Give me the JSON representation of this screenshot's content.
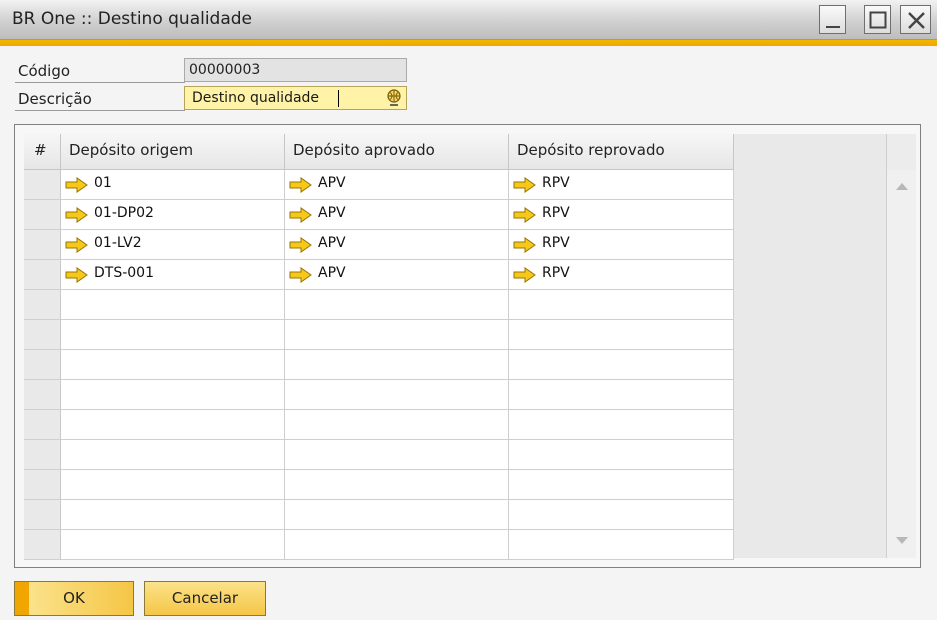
{
  "window": {
    "title": "BR One :: Destino qualidade",
    "controls": [
      "minimize",
      "maximize",
      "close"
    ]
  },
  "form": {
    "code_label": "Código",
    "code_value": "00000003",
    "description_label": "Descrição",
    "description_value": "Destino qualidade"
  },
  "grid": {
    "columns": [
      "#",
      "Depósito origem",
      "Depósito aprovado",
      "Depósito reprovado"
    ],
    "rows": [
      {
        "origem": "01",
        "aprovado": "APV",
        "reprovado": "RPV"
      },
      {
        "origem": "01-DP02",
        "aprovado": "APV",
        "reprovado": "RPV"
      },
      {
        "origem": "01-LV2",
        "aprovado": "APV",
        "reprovado": "RPV"
      },
      {
        "origem": "DTS-001",
        "aprovado": "APV",
        "reprovado": "RPV"
      }
    ],
    "empty_rows": 9
  },
  "buttons": {
    "ok": "OK",
    "cancel": "Cancelar"
  },
  "colors": {
    "accent": "#f0a500",
    "active_field": "#fff3a8",
    "button": "#f5c646"
  },
  "icons": {
    "link_arrow": "yellow-right-arrow-icon",
    "lookup": "globe-search-icon"
  }
}
